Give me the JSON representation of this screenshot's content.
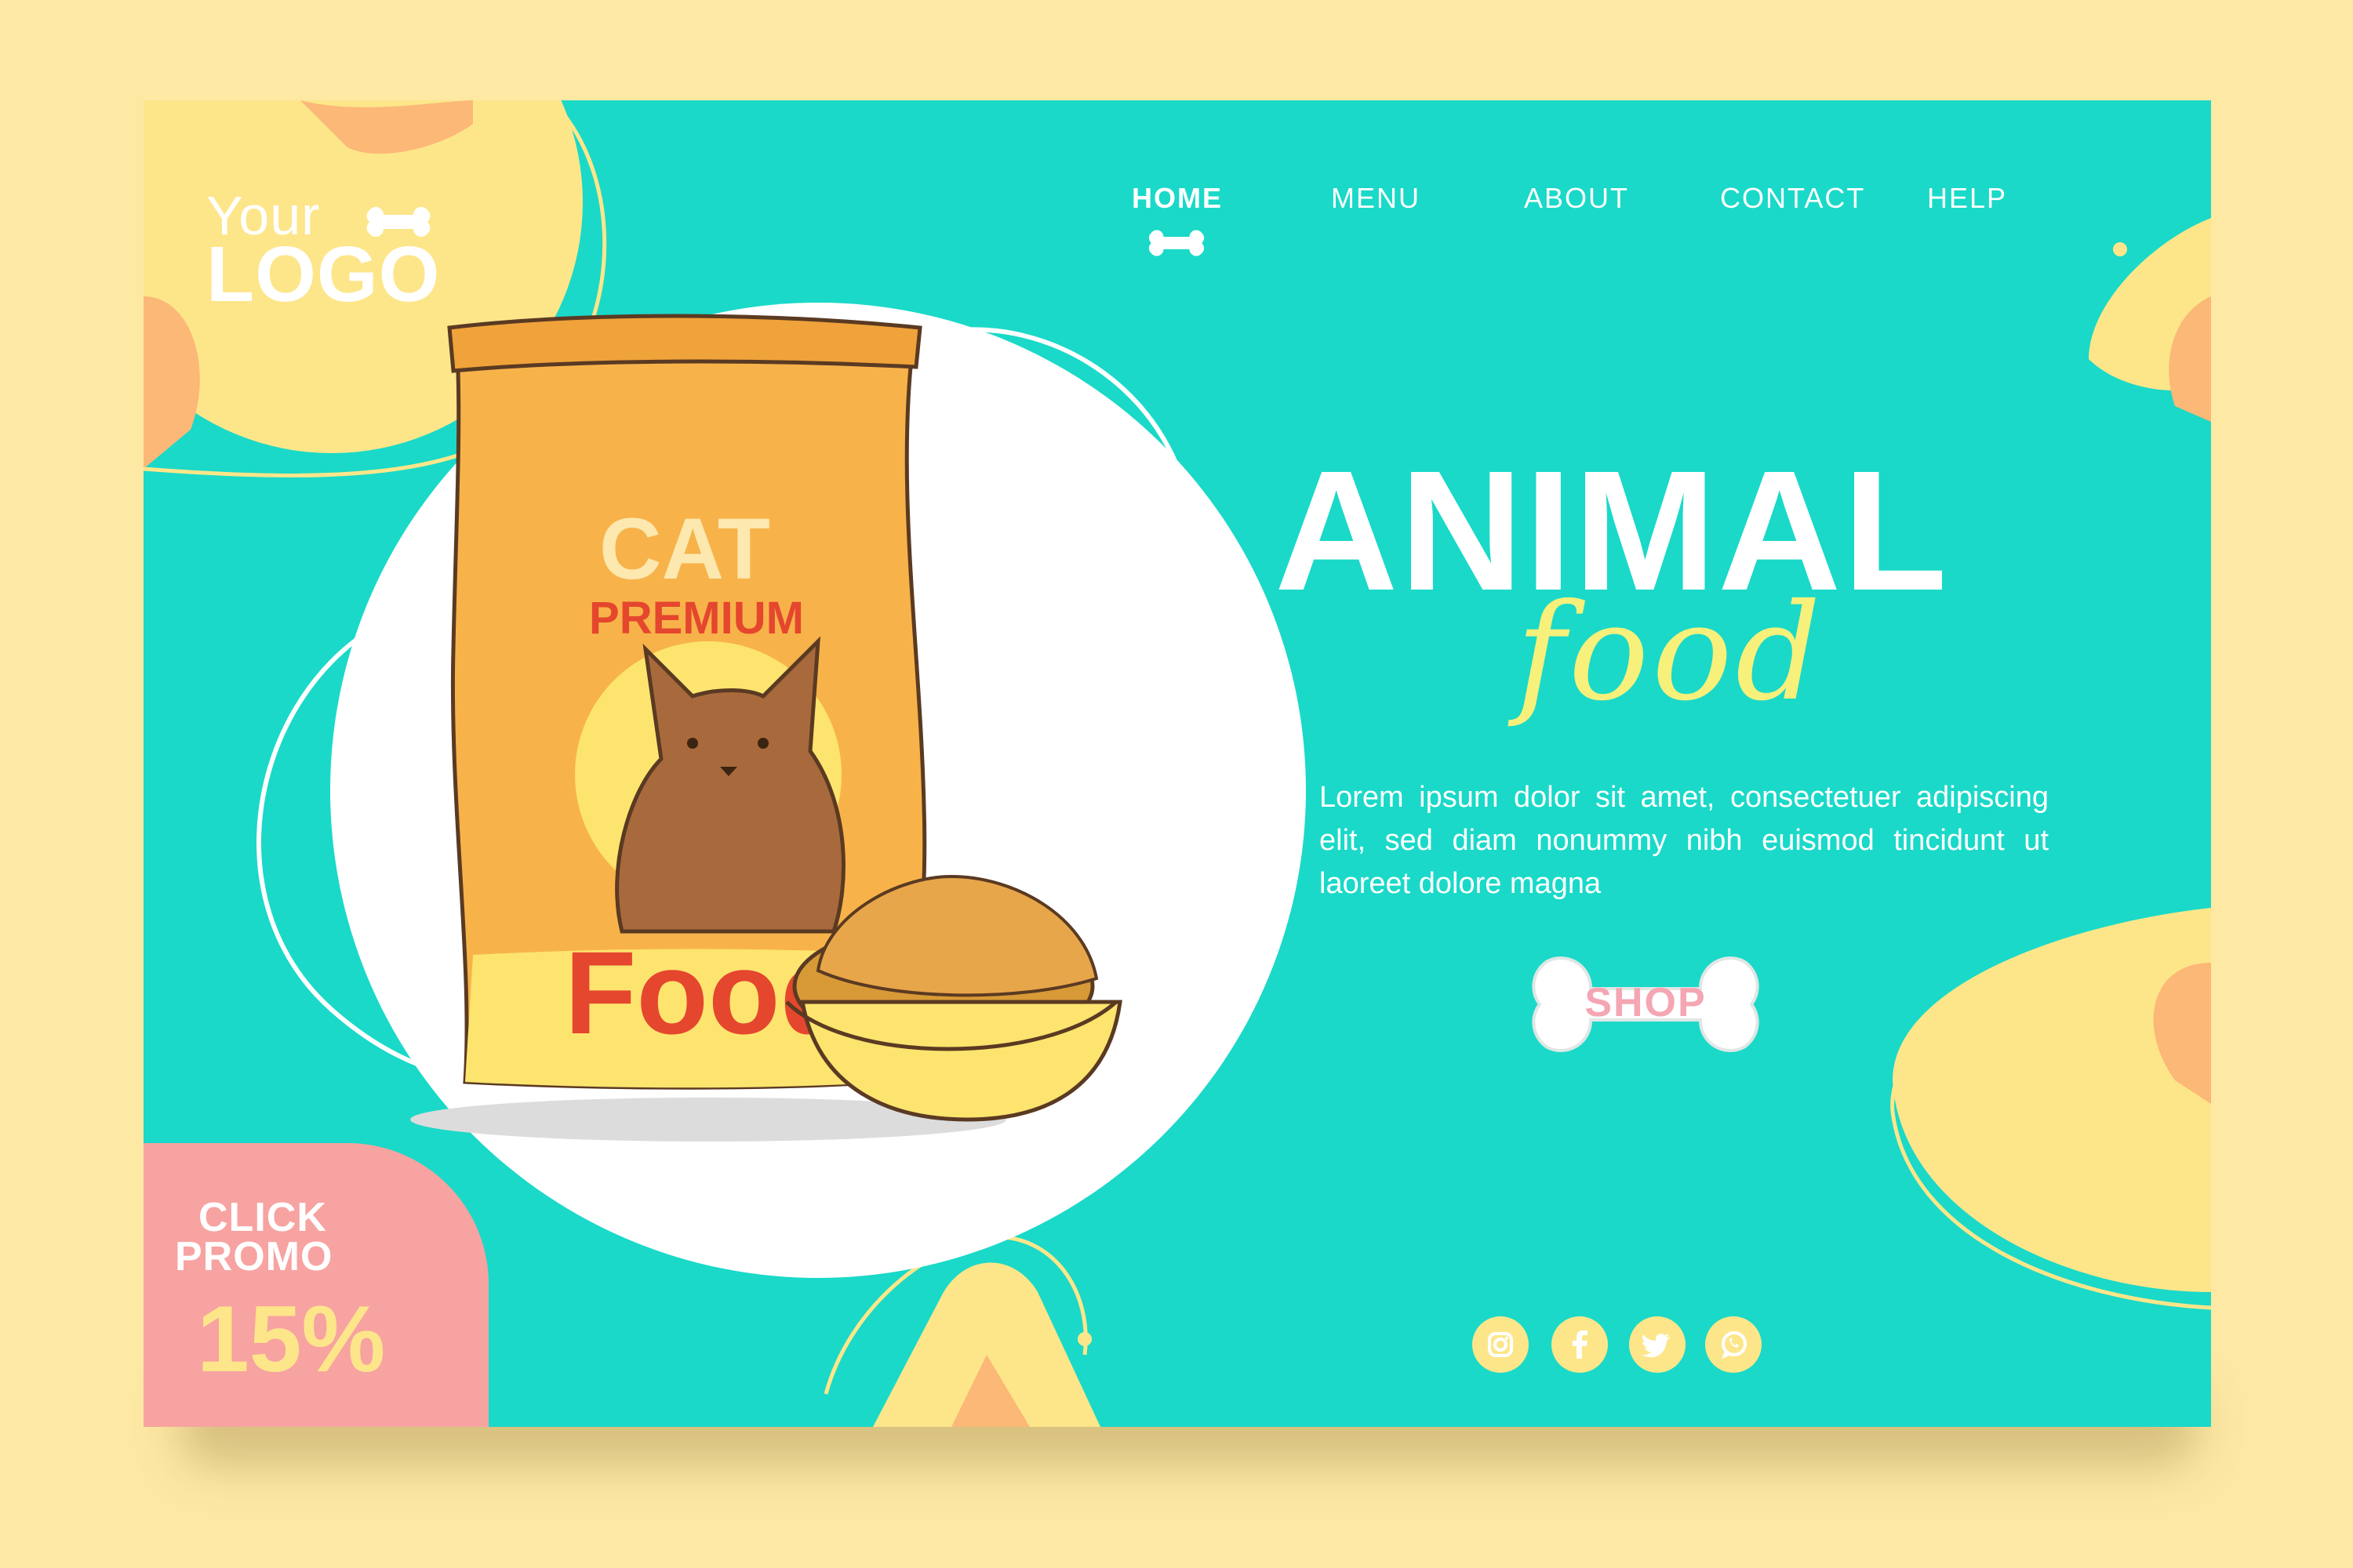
{
  "logo": {
    "line1": "Your",
    "line2": "LOGO"
  },
  "nav": {
    "items": [
      {
        "label": "HOME",
        "active": true
      },
      {
        "label": "MENU",
        "active": false
      },
      {
        "label": "ABOUT",
        "active": false
      },
      {
        "label": "CONTACT",
        "active": false
      },
      {
        "label": "HELP",
        "active": false
      }
    ]
  },
  "hero": {
    "title": "ANIMAL",
    "subtitle": "food",
    "description": "Lorem ipsum dolor sit amet, consectetuer adipiscing elit, sed diam nonummy nibh euismod tincidunt ut laoreet dolore magna",
    "cta_label": "SHOP"
  },
  "product": {
    "bag_line1": "CAT",
    "bag_line2": "PREMIUM",
    "bag_line3": "Food"
  },
  "promo": {
    "line1": "CLICK",
    "line2": "PROMO",
    "discount": "15%"
  },
  "social": [
    "instagram-icon",
    "facebook-icon",
    "twitter-icon",
    "whatsapp-icon"
  ],
  "colors": {
    "page_bg": "#fde8a4",
    "card_bg": "#1ad9c8",
    "accent_yellow": "#fde68a",
    "accent_orange": "#fbb877",
    "promo_pink": "#f7a3a1",
    "shop_text": "#f4a6b3"
  }
}
